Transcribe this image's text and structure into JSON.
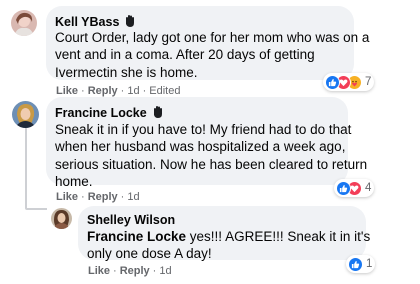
{
  "comments": [
    {
      "author": "Kell YBass",
      "badge_icon": "wave-hand-icon",
      "text_lines": [
        "Court Order, lady got one for her mom who was on a",
        "vent and in a coma. After 20 days of getting",
        "Ivermectin she is home."
      ],
      "actions": {
        "like": "Like",
        "reply": "Reply",
        "time": "1d",
        "edited": "Edited"
      },
      "reactions": {
        "icons": [
          "like",
          "love",
          "care"
        ],
        "count": "7"
      }
    },
    {
      "author": "Francine Locke",
      "badge_icon": "wave-hand-icon",
      "text_lines": [
        "Sneak it in if you have to! My friend had to do that",
        "when her husband was hospitalized a week ago,",
        "serious situation. Now he has been cleared to return",
        "home."
      ],
      "actions": {
        "like": "Like",
        "reply": "Reply",
        "time": "1d"
      },
      "reactions": {
        "icons": [
          "like",
          "love"
        ],
        "count": "4"
      }
    },
    {
      "author": "Shelley Wilson",
      "mention": "Francine Locke",
      "text_first_rest": " yes!!! AGREE!!! Sneak it in it's",
      "text_lines": [
        "only one dose A day!"
      ],
      "actions": {
        "like": "Like",
        "reply": "Reply",
        "time": "1d"
      },
      "reactions": {
        "icons": [
          "like"
        ],
        "count": "1"
      }
    }
  ],
  "colors": {
    "like": "#1877f2",
    "love": "#f33e58",
    "care": "#f7b125",
    "bubble": "#f0f2f5",
    "meta_text": "#65676b"
  }
}
